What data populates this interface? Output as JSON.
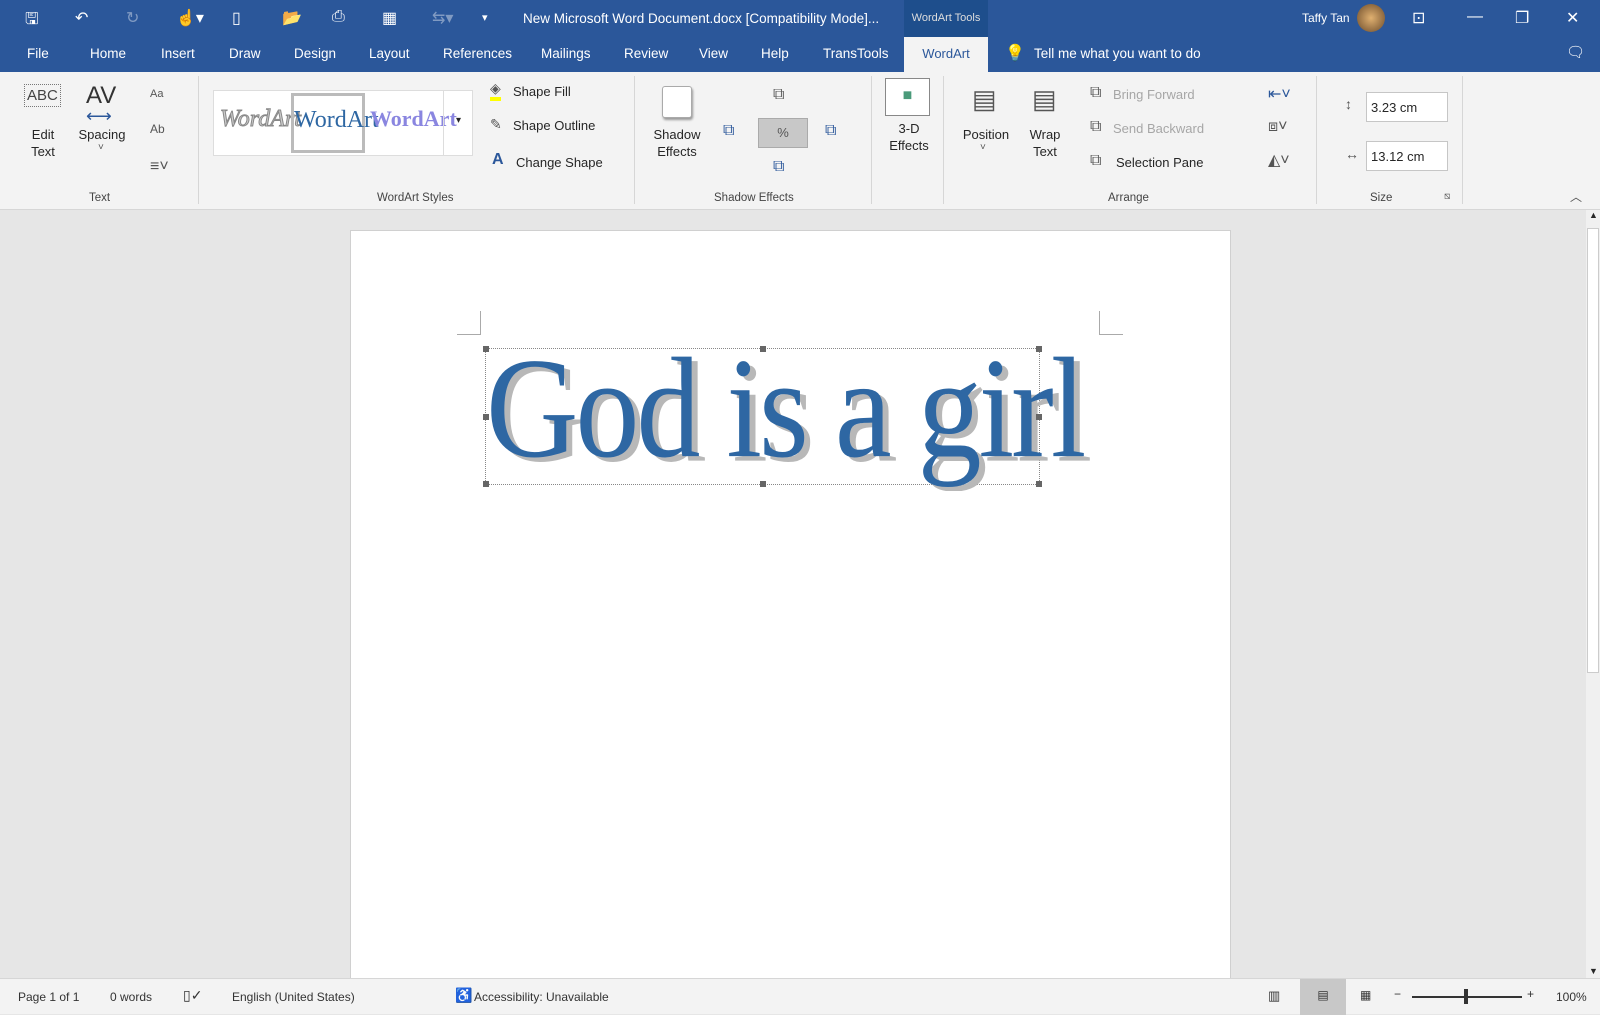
{
  "window": {
    "title": "New Microsoft Word Document.docx [Compatibility Mode]...",
    "context_tab_group": "WordArt Tools",
    "user": "Taffy Tan"
  },
  "tabs": [
    "File",
    "Home",
    "Insert",
    "Draw",
    "Design",
    "Layout",
    "References",
    "Mailings",
    "Review",
    "View",
    "Help",
    "TransTools",
    "WordArt"
  ],
  "tell_me": "Tell me what you want to do",
  "ribbon": {
    "text_group": {
      "edit_text": "Edit Text",
      "spacing": "Spacing",
      "label": "Text"
    },
    "styles_group": {
      "gallery": [
        "WordArt",
        "WordArt",
        "WordArt"
      ],
      "shape_fill": "Shape Fill",
      "shape_outline": "Shape Outline",
      "change_shape": "Change Shape",
      "label": "WordArt Styles"
    },
    "shadow_group": {
      "shadow_effects": "Shadow Effects",
      "label": "Shadow Effects"
    },
    "effects_3d": {
      "label": "3-D Effects"
    },
    "arrange_group": {
      "position": "Position",
      "wrap_text": "Wrap Text",
      "bring_forward": "Bring Forward",
      "send_backward": "Send Backward",
      "selection_pane": "Selection Pane",
      "label": "Arrange"
    },
    "size_group": {
      "height": "3.23 cm",
      "width": "13.12 cm",
      "label": "Size"
    }
  },
  "document": {
    "wordart_text": "God is a girl"
  },
  "status": {
    "page": "Page 1 of 1",
    "words": "0 words",
    "language": "English (United States)",
    "accessibility": "Accessibility: Unavailable",
    "zoom": "100%",
    "zoom_level_percent": 100
  },
  "colors": {
    "accent": "#2b579a",
    "wordart": "#2e67a3"
  }
}
